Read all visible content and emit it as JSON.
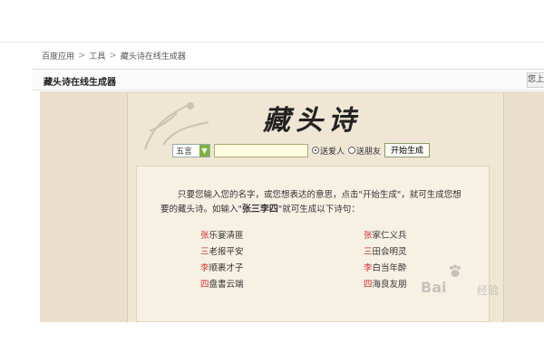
{
  "breadcrumb": {
    "items": [
      "百度应用",
      "工具",
      "藏头诗在线生成器"
    ],
    "separator": ">"
  },
  "titlebar": {
    "title": "藏头诗在线生成器",
    "right_button": "您上"
  },
  "app": {
    "title": "藏头诗",
    "form": {
      "type_select_value": "五言",
      "name_value": "",
      "radio_lover_label": "送爱人",
      "radio_friend_label": "送朋友",
      "generate_label": "开始生成"
    },
    "intro_line1": "只要您输入您的名字，或您想表达的意思，点击\"开始生成\"，就可生成您想",
    "intro_line2_prefix": "要的藏头诗。如输入\"",
    "intro_example": "张三李四",
    "intro_line2_suffix": "\"就可生成以下诗句：",
    "poem_left": [
      {
        "head": "张",
        "rest": "乐宴清匪"
      },
      {
        "head": "三",
        "rest": "老报平安"
      },
      {
        "head": "李",
        "rest": "顺裹才子"
      },
      {
        "head": "四",
        "rest": "盘書云端"
      }
    ],
    "poem_right": [
      {
        "head": "张",
        "rest": "家仁义兵"
      },
      {
        "head": "三",
        "rest": "田会明灵"
      },
      {
        "head": "李",
        "rest": "白当年酔"
      },
      {
        "head": "四",
        "rest": "海良友朋"
      }
    ]
  },
  "watermark": {
    "text": "Bai",
    "text2": "经验"
  },
  "colors": {
    "poem_head": "#d32f2f",
    "paper": "#e9dfcc",
    "panel": "#f7f1e4",
    "select_arrow": "#7cb342"
  }
}
